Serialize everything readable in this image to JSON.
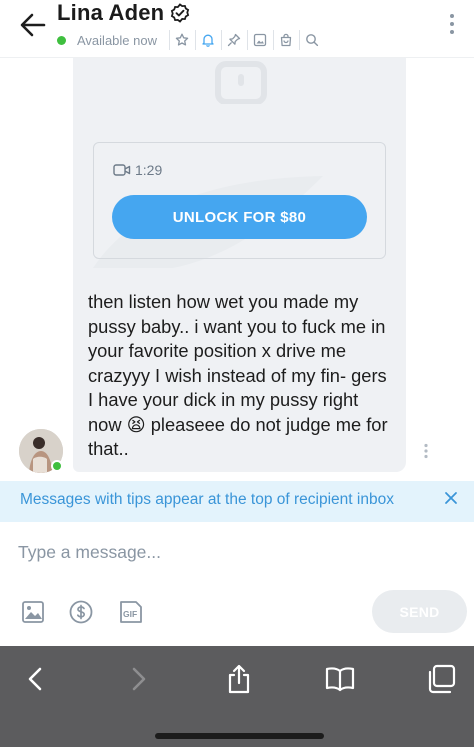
{
  "header": {
    "contact_name": "Lina Aden",
    "status": "Available now",
    "status_color": "#3fbf3f",
    "toolbar_icons": [
      "star-icon",
      "bell-icon",
      "pin-icon",
      "image-icon",
      "bag-icon",
      "search-icon"
    ],
    "accent_color": "#45a6f0"
  },
  "locked_media": {
    "duration": "1:29",
    "unlock_label": "UNLOCK FOR $80"
  },
  "message": {
    "text": "then listen how wet you made my pussy baby.. i want you to fuck me in your favorite position x drive me crazyyy I wish instead of my fin- gers I have your dick in my pussy right now 😫 pleaseee do not judge me for that.."
  },
  "tip_banner": {
    "text": "Messages with tips appear at the top of recipient inbox"
  },
  "composer": {
    "placeholder": "Type a message...",
    "send_label": "SEND"
  }
}
